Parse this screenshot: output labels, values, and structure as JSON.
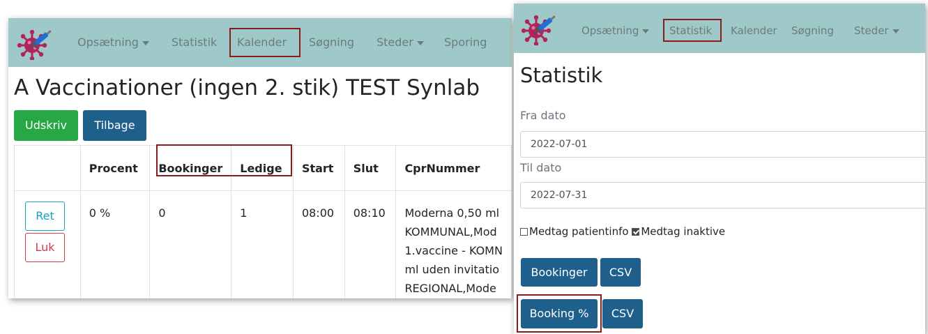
{
  "left": {
    "nav": {
      "items": [
        {
          "label": "Opsætning",
          "dropdown": true
        },
        {
          "label": "Statistik"
        },
        {
          "label": "Kalender",
          "highlighted": true
        },
        {
          "label": "Søgning"
        },
        {
          "label": "Steder",
          "dropdown": true
        },
        {
          "label": "Sporing"
        }
      ]
    },
    "page_title": "A Vaccinationer (ingen 2. stik) TEST Synlab",
    "buttons": {
      "print": "Udskriv",
      "back": "Tilbage"
    },
    "table": {
      "headers": [
        "",
        "Procent",
        "Bookinger",
        "Ledige",
        "Start",
        "Slut",
        "CprNummer"
      ],
      "rows": [
        {
          "edit_label": "Ret",
          "close_label": "Luk",
          "procent": "0 %",
          "bookinger": "0",
          "ledige": "1",
          "start": "08:00",
          "slut": "08:10",
          "cpr_lines": [
            "Moderna 0,50 ml",
            "KOMMUNAL,Mod",
            "1.vaccine - KOMN",
            "ml uden invitatio",
            "REGIONAL,Mode"
          ]
        }
      ]
    }
  },
  "right": {
    "nav": {
      "items": [
        {
          "label": "Opsætning",
          "dropdown": true
        },
        {
          "label": "Statistik",
          "highlighted": true
        },
        {
          "label": "Kalender"
        },
        {
          "label": "Søgning"
        },
        {
          "label": "Steder",
          "dropdown": true
        }
      ]
    },
    "page_title": "Statistik",
    "from_label": "Fra dato",
    "from_value": "2022-07-01",
    "to_label": "Til dato",
    "to_value": "2022-07-31",
    "include_patientinfo": {
      "label": "Medtag patientinfo",
      "checked": false
    },
    "include_inactive": {
      "label": "Medtag inaktive",
      "checked": true
    },
    "buttons": {
      "bookinger": "Bookinger",
      "csv1": "CSV",
      "booking_pct": "Booking %",
      "csv2": "CSV"
    }
  },
  "colors": {
    "navbar": "#9fc9c8",
    "nav_text": "#6b7c7b",
    "highlight_border": "#8b1a1a",
    "primary_button": "#1f5f8b",
    "success_button": "#28a745",
    "virus_logo": "#b0245a",
    "syringe": "#1d6fd6"
  },
  "icons": {
    "logo": "virus-syringe-icon",
    "dropdown": "caret-down-icon"
  }
}
